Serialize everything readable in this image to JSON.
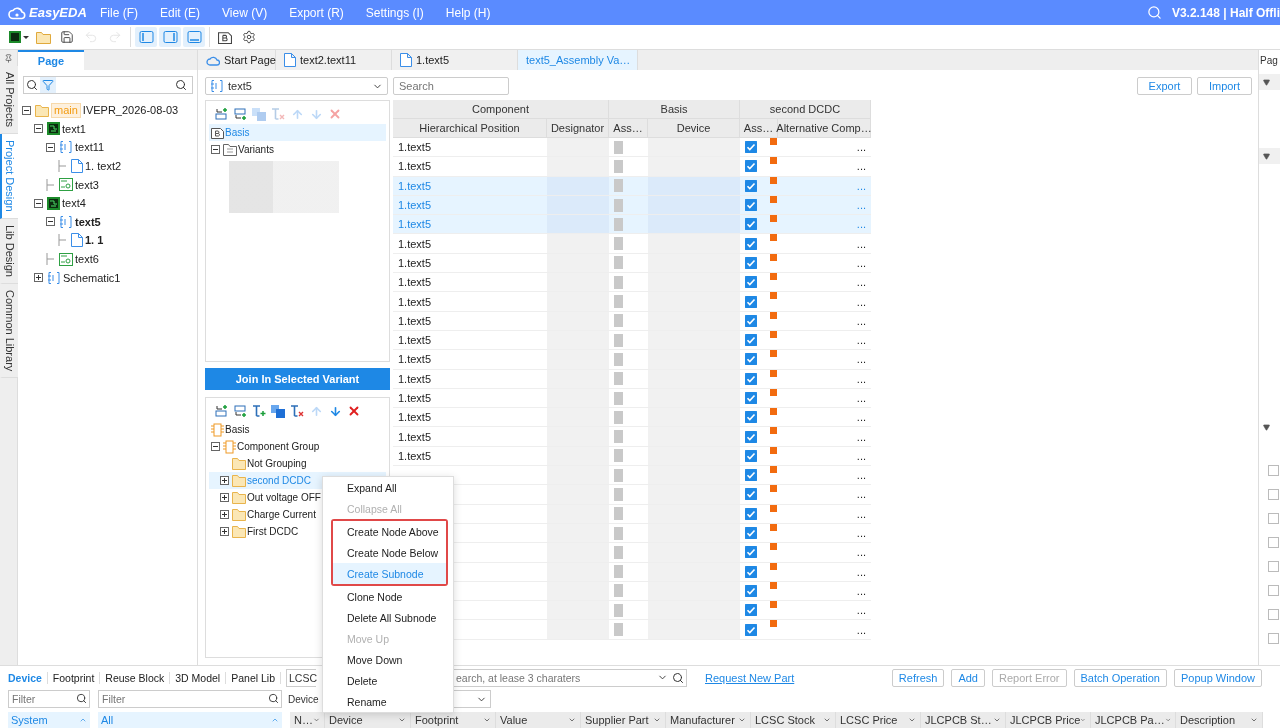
{
  "app": {
    "logo": "EasyEDA",
    "menus": [
      "File (F)",
      "Edit (E)",
      "View (V)",
      "Export (R)",
      "Settings (I)",
      "Help (H)"
    ],
    "version": "V3.2.148 | Half Offli"
  },
  "toolbar": [
    [
      {
        "kind": "new",
        "disabled": false,
        "on": false
      },
      {
        "kind": "open",
        "disabled": false,
        "on": false
      },
      {
        "kind": "save",
        "disabled": false,
        "on": false
      },
      {
        "kind": "undo",
        "disabled": true,
        "on": false
      },
      {
        "kind": "redo",
        "disabled": true,
        "on": false
      }
    ],
    [
      {
        "kind": "left-panel",
        "disabled": false,
        "on": true
      },
      {
        "kind": "right-panel",
        "disabled": false,
        "on": true
      },
      {
        "kind": "bottom-panel",
        "disabled": false,
        "on": true
      }
    ],
    [
      {
        "kind": "document",
        "disabled": false,
        "on": false
      },
      {
        "kind": "settings",
        "disabled": false,
        "on": false
      }
    ]
  ],
  "side_tabs": [
    {
      "label": "All Projects",
      "selected": false
    },
    {
      "label": "Project Design",
      "selected": true
    },
    {
      "label": "Lib Design",
      "selected": false
    },
    {
      "label": "Common Library",
      "selected": false
    }
  ],
  "page_panel": {
    "tab": "Page",
    "filter_on": true,
    "tree": [
      {
        "label": "IVEPR_2026-08-03",
        "badge": "main",
        "kind": "folder",
        "expanded": true,
        "active": false,
        "children": [
          {
            "label": "text1",
            "kind": "board",
            "expanded": true,
            "active": false,
            "children": [
              {
                "label": "text11",
                "kind": "schematic",
                "expanded": true,
                "active": false,
                "children": [
                  {
                    "label": "1. text2",
                    "kind": "page",
                    "active": false
                  }
                ]
              },
              {
                "label": "text3",
                "kind": "panel",
                "active": false
              }
            ]
          },
          {
            "label": "text4",
            "kind": "board",
            "expanded": true,
            "active": false,
            "children": [
              {
                "label": "text5",
                "kind": "schematic",
                "expanded": true,
                "active": true,
                "children": [
                  {
                    "label": "1. 1",
                    "kind": "page",
                    "active": true
                  }
                ]
              },
              {
                "label": "text6",
                "kind": "panel",
                "active": false
              }
            ]
          },
          {
            "label": "Schematic1",
            "kind": "schematic",
            "expanded": false,
            "active": false
          }
        ]
      }
    ]
  },
  "doc_tabs": [
    {
      "label": "Start Page",
      "kind": "cloud",
      "selected": false
    },
    {
      "label": "text2.text11",
      "kind": "page",
      "selected": false
    },
    {
      "label": "1.text5",
      "kind": "page",
      "selected": false
    },
    {
      "label": "text5_Assembly Va…",
      "kind": "plain",
      "selected": true
    }
  ],
  "variant_select": {
    "value": "text5"
  },
  "search": {
    "placeholder": "Search"
  },
  "actions": [
    "Export",
    "Import"
  ],
  "variants": {
    "toolbar": [
      {
        "kind": "add-above",
        "disabled": false
      },
      {
        "kind": "add-below",
        "disabled": false
      },
      {
        "kind": "copy",
        "disabled": true
      },
      {
        "kind": "remove-tree",
        "disabled": true
      },
      {
        "kind": "up",
        "disabled": true
      },
      {
        "kind": "down",
        "disabled": true
      },
      {
        "kind": "delete",
        "disabled": true
      }
    ],
    "tree": [
      {
        "label": "Basis",
        "kind": "basis",
        "selected": true
      },
      {
        "label": "Variants",
        "kind": "variants",
        "expanded": true,
        "selected": false
      }
    ]
  },
  "join_button": "Join In Selected Variant",
  "groups": {
    "toolbar": [
      {
        "kind": "add-above",
        "disabled": false
      },
      {
        "kind": "add-below",
        "disabled": false
      },
      {
        "kind": "add-sub",
        "disabled": false
      },
      {
        "kind": "copy",
        "disabled": false
      },
      {
        "kind": "remove-tree",
        "disabled": false
      },
      {
        "kind": "up",
        "disabled": true
      },
      {
        "kind": "down",
        "disabled": false
      },
      {
        "kind": "delete",
        "disabled": false
      }
    ],
    "tree": [
      {
        "label": "Basis",
        "kind": "chip",
        "selected": false
      },
      {
        "label": "Component Group",
        "kind": "chip",
        "expanded": true,
        "selected": false,
        "children": [
          {
            "label": "Not Grouping",
            "kind": "folder",
            "selected": false
          },
          {
            "label": "second DCDC",
            "kind": "folder",
            "expanded": false,
            "selected": true
          },
          {
            "label": "Out voltage OFF",
            "kind": "folder",
            "expanded": false,
            "selected": false
          },
          {
            "label": "Charge Current",
            "kind": "folder",
            "expanded": false,
            "selected": false
          },
          {
            "label": "First DCDC",
            "kind": "folder",
            "expanded": false,
            "selected": false
          }
        ]
      }
    ]
  },
  "table": {
    "groups": [
      "Component",
      "Basis",
      "second DCDC"
    ],
    "columns": [
      {
        "label": "Hierarchical Position",
        "kind": "position"
      },
      {
        "label": "Designator",
        "kind": "hidden"
      },
      {
        "label": "Ass…",
        "kind": "locked"
      },
      {
        "label": "Device",
        "kind": "hidden"
      },
      {
        "label": "Ass…",
        "kind": "check"
      },
      {
        "label": "Alternative Comp…",
        "kind": "more"
      }
    ],
    "rows": [
      {
        "position": "1.text5",
        "selected": false,
        "assigned": true,
        "more": "..."
      },
      {
        "position": "1.text5",
        "selected": false,
        "assigned": true,
        "more": "..."
      },
      {
        "position": "1.text5",
        "selected": true,
        "assigned": true,
        "more": "..."
      },
      {
        "position": "1.text5",
        "selected": true,
        "assigned": true,
        "more": "..."
      },
      {
        "position": "1.text5",
        "selected": true,
        "assigned": true,
        "more": "..."
      },
      {
        "position": "1.text5",
        "selected": false,
        "assigned": true,
        "more": "..."
      },
      {
        "position": "1.text5",
        "selected": false,
        "assigned": true,
        "more": "..."
      },
      {
        "position": "1.text5",
        "selected": false,
        "assigned": true,
        "more": "..."
      },
      {
        "position": "1.text5",
        "selected": false,
        "assigned": true,
        "more": "..."
      },
      {
        "position": "1.text5",
        "selected": false,
        "assigned": true,
        "more": "..."
      },
      {
        "position": "1.text5",
        "selected": false,
        "assigned": true,
        "more": "..."
      },
      {
        "position": "1.text5",
        "selected": false,
        "assigned": true,
        "more": "..."
      },
      {
        "position": "1.text5",
        "selected": false,
        "assigned": true,
        "more": "..."
      },
      {
        "position": "1.text5",
        "selected": false,
        "assigned": true,
        "more": "..."
      },
      {
        "position": "1.text5",
        "selected": false,
        "assigned": true,
        "more": "..."
      },
      {
        "position": "1.text5",
        "selected": false,
        "assigned": true,
        "more": "..."
      },
      {
        "position": "1.text5",
        "selected": false,
        "assigned": true,
        "more": "..."
      },
      {
        "selected": false,
        "assigned": true,
        "more": "..."
      },
      {
        "selected": false,
        "assigned": true,
        "more": "..."
      },
      {
        "selected": false,
        "assigned": true,
        "more": "..."
      },
      {
        "selected": false,
        "assigned": true,
        "more": "..."
      },
      {
        "selected": false,
        "assigned": true,
        "more": "..."
      },
      {
        "selected": false,
        "assigned": true,
        "more": "..."
      },
      {
        "selected": false,
        "assigned": true,
        "more": "..."
      },
      {
        "selected": false,
        "assigned": true,
        "more": "..."
      },
      {
        "selected": false,
        "assigned": true,
        "more": "..."
      }
    ]
  },
  "context_menu": {
    "items": [
      {
        "label": "Expand All",
        "disabled": false,
        "selected": false,
        "outlined": false
      },
      {
        "label": "Collapse All",
        "disabled": true,
        "selected": false,
        "outlined": false
      },
      {
        "label": "Create Node Above",
        "disabled": false,
        "selected": false,
        "outlined": true
      },
      {
        "label": "Create Node Below",
        "disabled": false,
        "selected": false,
        "outlined": true
      },
      {
        "label": "Create Subnode",
        "disabled": false,
        "selected": true,
        "outlined": true
      },
      {
        "label": "Clone Node",
        "disabled": false,
        "selected": false,
        "outlined": false
      },
      {
        "label": "Delete All Subnode",
        "disabled": false,
        "selected": false,
        "outlined": false
      },
      {
        "label": "Move Up",
        "disabled": true,
        "selected": false,
        "outlined": false
      },
      {
        "label": "Move Down",
        "disabled": false,
        "selected": false,
        "outlined": false
      },
      {
        "label": "Delete",
        "disabled": false,
        "selected": false,
        "outlined": false
      },
      {
        "label": "Rename",
        "disabled": false,
        "selected": false,
        "outlined": false
      }
    ]
  },
  "bottom": {
    "tabs": [
      {
        "label": "Device",
        "selected": true
      },
      {
        "label": "Footprint",
        "selected": false
      },
      {
        "label": "Reuse Block",
        "selected": false
      },
      {
        "label": "3D Model",
        "selected": false
      },
      {
        "label": "Panel Lib",
        "selected": false
      }
    ],
    "source": "LCSC",
    "search": {
      "placeholder": "earch, at lease 3 charaters"
    },
    "link": "Request New Part",
    "buttons": [
      {
        "label": "Refresh",
        "disabled": false
      },
      {
        "label": "Add",
        "disabled": false
      },
      {
        "label": "Report Error",
        "disabled": true
      },
      {
        "label": "Batch Operation",
        "disabled": false
      },
      {
        "label": "Popup Window",
        "disabled": false
      }
    ],
    "filters": [
      {
        "placeholder": "Filter"
      },
      {
        "placeholder": "Filter"
      }
    ],
    "type_label": "Device",
    "categories": [
      {
        "label": "System",
        "selected": true
      }
    ],
    "libraries": [
      {
        "label": "All",
        "selected": true
      }
    ],
    "columns": [
      "N…",
      "Device",
      "Footprint",
      "Value",
      "Supplier Part",
      "Manufacturer",
      "LCSC Stock",
      "LCSC Price",
      "JLCPCB St…",
      "JLCPCB Price",
      "JLCPCB Pa…",
      "Description"
    ]
  },
  "right_panel": {
    "title": "Pag",
    "checks": [
      {
        "checked": false
      },
      {
        "checked": false
      },
      {
        "checked": false
      },
      {
        "checked": false
      },
      {
        "checked": false
      },
      {
        "checked": false
      },
      {
        "checked": false
      },
      {
        "checked": false
      }
    ]
  }
}
